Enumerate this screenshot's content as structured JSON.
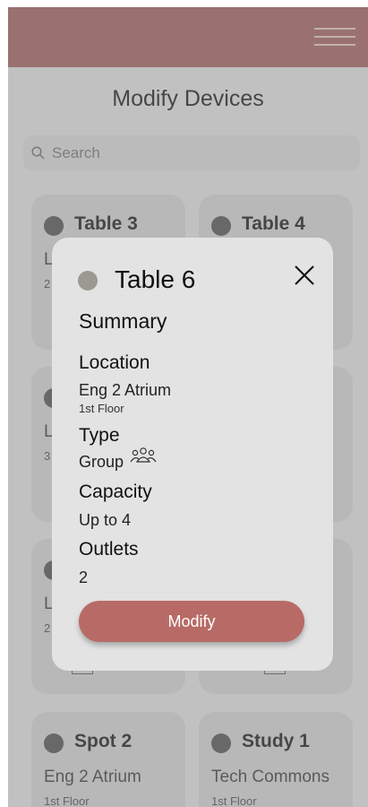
{
  "header": {
    "menu_icon": "hamburger-icon"
  },
  "page": {
    "title": "Modify Devices"
  },
  "search": {
    "placeholder": "Search",
    "icon": "search-icon"
  },
  "cards": [
    {
      "name": "Table 3",
      "location": "L",
      "floor": "2"
    },
    {
      "name": "Table 4",
      "location": "",
      "floor": ""
    },
    {
      "name": "",
      "location": "L",
      "floor": "3"
    },
    {
      "name": "",
      "location": "",
      "floor": ""
    },
    {
      "name": "",
      "location": "L",
      "floor": "2"
    },
    {
      "name": "",
      "location": "",
      "floor": ""
    },
    {
      "name": "Spot 2",
      "location": "Eng 2 Atrium",
      "floor": "1st Floor"
    },
    {
      "name": "Study 1",
      "location": "Tech Commons",
      "floor": "1st Floor"
    }
  ],
  "modal": {
    "title": "Table 6",
    "summary_heading": "Summary",
    "location_heading": "Location",
    "location_value": "Eng 2 Atrium",
    "floor": "1st Floor",
    "type_heading": "Type",
    "type_value": "Group",
    "type_icon": "group-icon",
    "capacity_heading": "Capacity",
    "capacity_value": "Up to 4",
    "outlets_heading": "Outlets",
    "outlets_value": "2",
    "modify_label": "Modify"
  },
  "colors": {
    "header": "#a05a56",
    "button": "#b86b66",
    "modal_dot": "#9a9a92"
  }
}
